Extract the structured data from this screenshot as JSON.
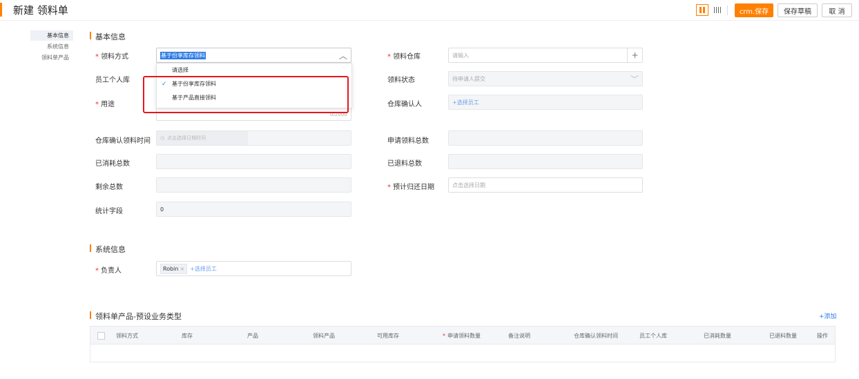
{
  "header": {
    "title": "新建 领料单",
    "save_label": "crm.保存",
    "draft_label": "保存草稿",
    "cancel_label": "取 消"
  },
  "leftnav": [
    "基本信息",
    "系统信息",
    "领料单产品"
  ],
  "basic": {
    "section_title": "基本信息",
    "method_label": "领料方式",
    "method_value": "基于份享库存领料",
    "warehouse_label": "领料仓库",
    "warehouse_placeholder": "请输入",
    "personal_label": "员工个人库",
    "status_label": "领料状态",
    "status_value": "待申请人提交",
    "purpose_label": "用途",
    "confirmer_label": "仓库确认人",
    "confirmer_placeholder": "+选择员工",
    "purpose_counter": "0/2000",
    "confirm_time_label": "仓库确认领料时间",
    "confirm_time_placeholder": "点击选择日期时间",
    "apply_total_label": "申请领料总数",
    "consumed_total_label": "已消耗总数",
    "returned_total_label": "已退料总数",
    "remaining_total_label": "剩余总数",
    "return_date_label": "预计归还日期",
    "return_date_placeholder": "点击选择日期",
    "stat_label": "统计字段",
    "stat_value": "0"
  },
  "dropdown": {
    "options": [
      "请选择",
      "基于份享库存领料",
      "基于产品直接领料"
    ],
    "selected_index": 1
  },
  "system": {
    "section_title": "系统信息",
    "owner_label": "负责人",
    "owner_tag": "Robin",
    "owner_add": "+选择员工"
  },
  "products": {
    "section_title": "领料单产品-预设业务类型",
    "add_label": "+添加",
    "columns": [
      "领料方式",
      "库存",
      "产品",
      "领料产品",
      "可用库存",
      "申请领料数量",
      "备注说明",
      "仓库确认领料时间",
      "员工个人库",
      "已消耗数量",
      "已退料数量",
      "操作"
    ]
  },
  "colors": {
    "accent": "#ff8000",
    "link": "#2d7be5",
    "required": "#f23",
    "highlight_box": "#e8151b"
  }
}
